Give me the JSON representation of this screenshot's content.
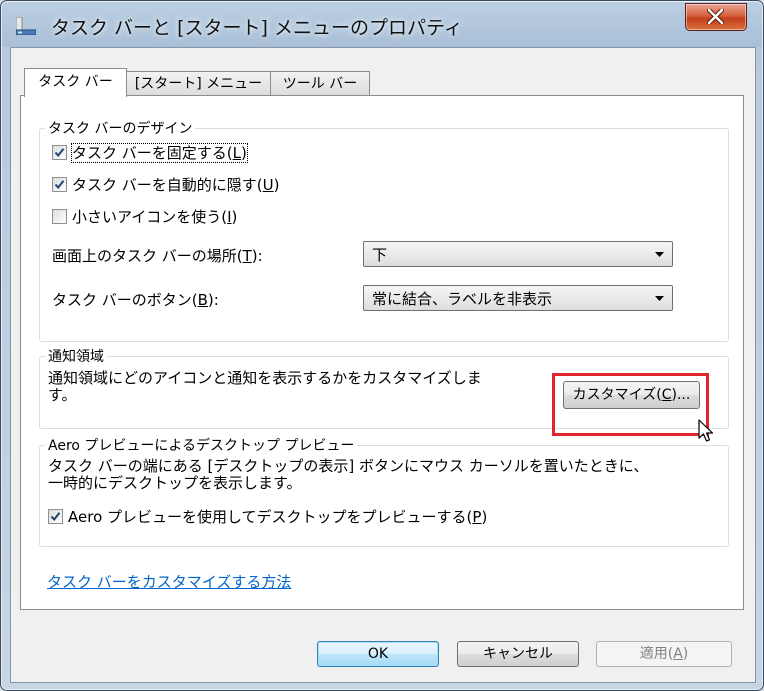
{
  "window": {
    "title": "タスク バーと [スタート] メニューのプロパティ",
    "icon": "taskbar-icon",
    "close_icon": "close-icon"
  },
  "tabs": [
    {
      "label": "タスク バー",
      "active": true
    },
    {
      "label": "[スタート] メニュー",
      "active": false
    },
    {
      "label": "ツール バー",
      "active": false
    }
  ],
  "design_group": {
    "title": "タスク バーのデザイン",
    "lock": {
      "label": "タスク バーを固定する(",
      "key": "L",
      "suffix": ")",
      "checked": true
    },
    "autohide": {
      "label": "タスク バーを自動的に隠す(",
      "key": "U",
      "suffix": ")",
      "checked": true
    },
    "small_icons": {
      "label": "小さいアイコンを使う(",
      "key": "I",
      "suffix": ")",
      "checked": false
    },
    "location": {
      "label": "画面上のタスク バーの場所(",
      "key": "T",
      "suffix": "):",
      "value": "下"
    },
    "buttons": {
      "label": "タスク バーのボタン(",
      "key": "B",
      "suffix": "):",
      "value": "常に結合、ラベルを非表示"
    }
  },
  "notify_group": {
    "title": "通知領域",
    "desc_line1": "通知領域にどのアイコンと通知を表示するかをカスタマイズしま",
    "desc_line2": "す。",
    "customize": {
      "label": "カスタマイズ(",
      "key": "C",
      "suffix": ")..."
    }
  },
  "aero_group": {
    "title": "Aero プレビューによるデスクトップ プレビュー",
    "desc_line1": "タスク バーの端にある [デスクトップの表示] ボタンにマウス カーソルを置いたときに、",
    "desc_line2": "一時的にデスクトップを表示します。",
    "peek": {
      "label": "Aero プレビューを使用してデスクトップをプレビューする(",
      "key": "P",
      "suffix": ")",
      "checked": true
    }
  },
  "help_link": "タスク バーをカスタマイズする方法",
  "buttons": {
    "ok": "OK",
    "cancel": "キャンセル",
    "apply": {
      "label": "適用(",
      "key": "A",
      "suffix": ")"
    }
  },
  "colors": {
    "highlight": "#e0252d",
    "link": "#0066cc"
  }
}
